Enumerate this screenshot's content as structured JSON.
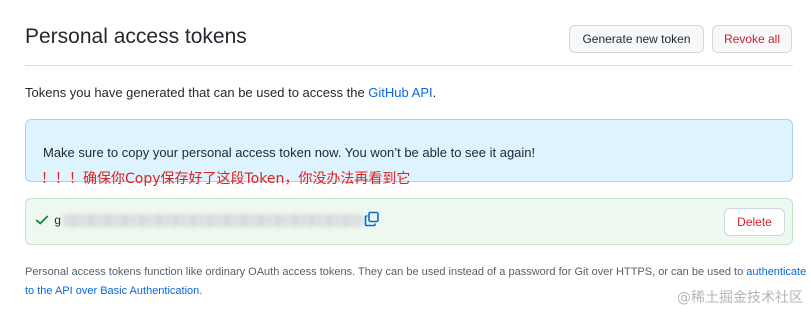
{
  "header": {
    "title": "Personal access tokens",
    "generate_label": "Generate new token",
    "revoke_label": "Revoke all"
  },
  "intro": {
    "text": "Tokens you have generated that can be used to access the ",
    "link": "GitHub API",
    "suffix": "."
  },
  "flash": {
    "message": "Make sure to copy your personal access token now. You won’t be able to see it again!"
  },
  "annotation": "！！！确保你Copy保存好了这段Token，你没办法再看到它",
  "token": {
    "prefix": "g",
    "delete_label": "Delete",
    "status_color": "#1a7f37",
    "icons": [
      "check-icon",
      "copy-icon"
    ]
  },
  "footer": {
    "text": "Personal access tokens function like ordinary OAuth access tokens. They can be used instead of a password for Git over HTTPS, or can be used to ",
    "link": "authenticate to the API over Basic Authentication",
    "suffix": "."
  },
  "watermark": "@稀土掘金技术社区",
  "colors": {
    "accent": "#0969da",
    "danger": "#cf222e",
    "flash_bg": "#ddf4ff",
    "success_bg": "#eef8f0",
    "annotation": "#e02020"
  }
}
